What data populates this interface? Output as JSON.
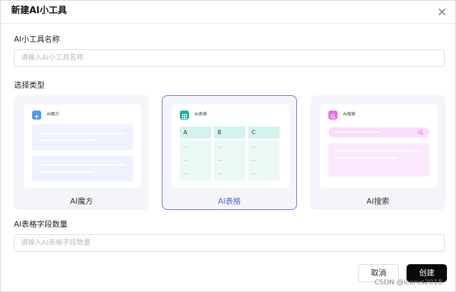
{
  "dialog": {
    "title": "新建AI小工具"
  },
  "form": {
    "name_label": "AI小工具名称",
    "name_placeholder": "请输入AI小工具名称",
    "name_value": "",
    "type_label": "选择类型",
    "field_count_label": "AI表格字段数量",
    "field_count_placeholder": "请输入AI表格字段数量",
    "field_count_value": ""
  },
  "types": [
    {
      "label": "AI魔方",
      "preview_title": "AI魔方",
      "selected": false,
      "icon": "sparkle-icon",
      "color": "#4a9bf5"
    },
    {
      "label": "AI表格",
      "preview_title": "AI表格",
      "selected": true,
      "icon": "table-icon",
      "color": "#17b59d",
      "columns": [
        "A",
        "B",
        "C"
      ],
      "cell_placeholder": "--"
    },
    {
      "label": "AI搜索",
      "preview_title": "AI搜索",
      "selected": false,
      "icon": "search-icon",
      "color": "#e46ef0"
    }
  ],
  "buttons": {
    "cancel": "取消",
    "create": "创建"
  },
  "watermark": "CSDN @Icarus2018",
  "colors": {
    "accent": "#6b6fe6",
    "primary_button": "#0a0a0a"
  }
}
